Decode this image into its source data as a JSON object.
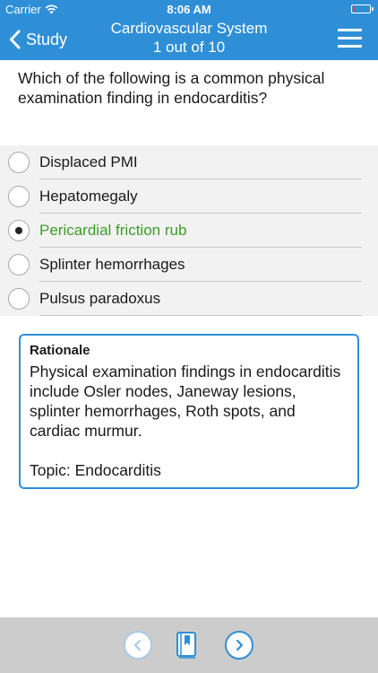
{
  "status_bar": {
    "carrier": "Carrier",
    "time": "8:06 AM",
    "battery_level": 0.1
  },
  "nav": {
    "back_label": "Study",
    "title": "Cardiovascular System",
    "subtitle": "1 out of 10"
  },
  "question": {
    "text": "Which of the following is a common physical examination finding in endocarditis?"
  },
  "answers": [
    {
      "label": "Displaced PMI",
      "selected": false,
      "correct": false
    },
    {
      "label": "Hepatomegaly",
      "selected": false,
      "correct": false
    },
    {
      "label": "Pericardial friction rub",
      "selected": true,
      "correct": false
    },
    {
      "label": "Splinter hemorrhages",
      "selected": false,
      "correct": false
    },
    {
      "label": "Pulsus paradoxus",
      "selected": false,
      "correct": false
    }
  ],
  "rationale": {
    "title": "Rationale",
    "body": "Physical examination findings in endocarditis include Osler nodes, Janeway lesions, splinter hemorrhages, Roth spots, and cardiac murmur.",
    "topic": "Topic: Endocarditis"
  },
  "colors": {
    "accent": "#2f8fd6",
    "selected_answer": "#3f9a2a",
    "toolbar_bg": "#cccccc",
    "answers_bg": "#f2f2f2"
  },
  "icons": {
    "back": "chevron-left-icon",
    "menu": "hamburger-menu-icon",
    "prev": "chevron-left-circle-icon",
    "bookmark": "bookmark-book-icon",
    "next": "chevron-right-circle-icon",
    "wifi": "wifi-icon",
    "battery": "battery-icon"
  }
}
